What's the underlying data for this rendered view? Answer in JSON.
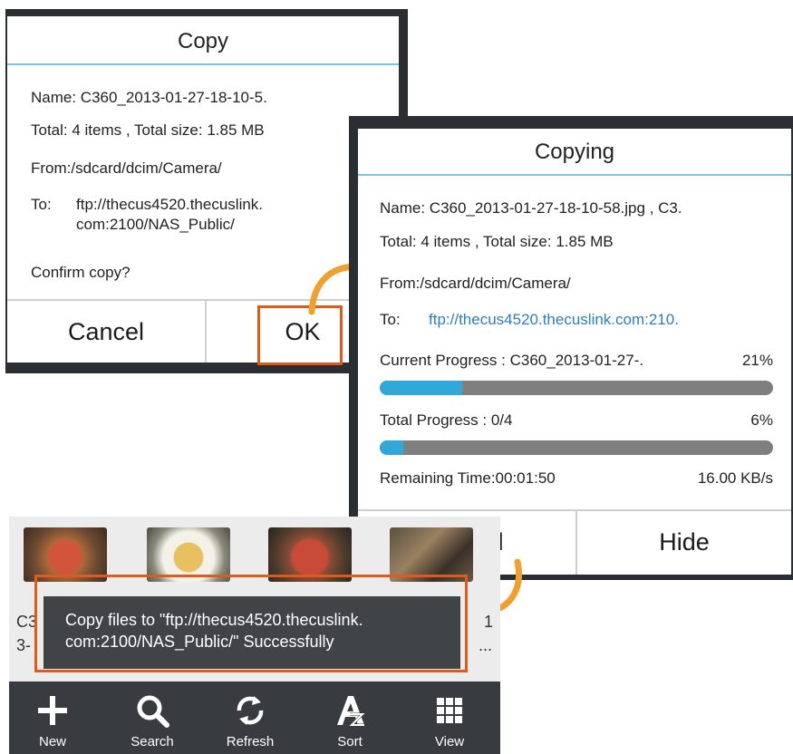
{
  "copy_dialog": {
    "title": "Copy",
    "name": "Name: C360_2013-01-27-18-10-5.",
    "total": "Total: 4 items , Total size: 1.85 MB",
    "from": "From:/sdcard/dcim/Camera/",
    "to_label": "To:",
    "to_line1": "ftp://thecus4520.thecuslink.",
    "to_line2": "com:2100/NAS_Public/",
    "confirm": "Confirm copy?",
    "cancel_label": "Cancel",
    "ok_label": "OK"
  },
  "copying_dialog": {
    "title": "Copying",
    "name": "Name: C360_2013-01-27-18-10-58.jpg , C3.",
    "total": "Total: 4 items , Total size: 1.85 MB",
    "from": "From:/sdcard/dcim/Camera/",
    "to_label": "To:",
    "to_value": "ftp://thecus4520.thecuslink.com:210.",
    "current_progress_label": "Current Progress : C360_2013-01-27-.",
    "current_progress_percent": "21%",
    "current_progress_value": 0.21,
    "total_progress_label": "Total Progress : 0/4",
    "total_progress_percent": "6%",
    "total_progress_value": 0.06,
    "remaining_time": "Remaining Time:00:01:50",
    "speed": "16.00 KB/s",
    "cancel_partial": "el",
    "hide_label": "Hide"
  },
  "file_browser": {
    "thumb_label_left_top": "C3",
    "thumb_label_left_bottom": "3-",
    "thumb_label_right_top": "1",
    "thumb_label_right_bottom": "...",
    "toast_line1": "Copy files to \"ftp://thecus4520.thecuslink.",
    "toast_line2": "com:2100/NAS_Public/\" Successfully",
    "toolbar": [
      {
        "label": "New",
        "icon": "plus-icon"
      },
      {
        "label": "Search",
        "icon": "search-icon"
      },
      {
        "label": "Refresh",
        "icon": "refresh-icon"
      },
      {
        "label": "Sort",
        "icon": "sort-icon"
      },
      {
        "label": "View",
        "icon": "grid-view-icon"
      }
    ]
  },
  "colors": {
    "accent_rule": "#7cc4e0",
    "highlight": "#e05a1c",
    "progress_fill": "#32a8d8",
    "progress_track": "#7f7f7f",
    "link_blue": "#2a7fc1",
    "arrow_orange": "#f0a030"
  }
}
